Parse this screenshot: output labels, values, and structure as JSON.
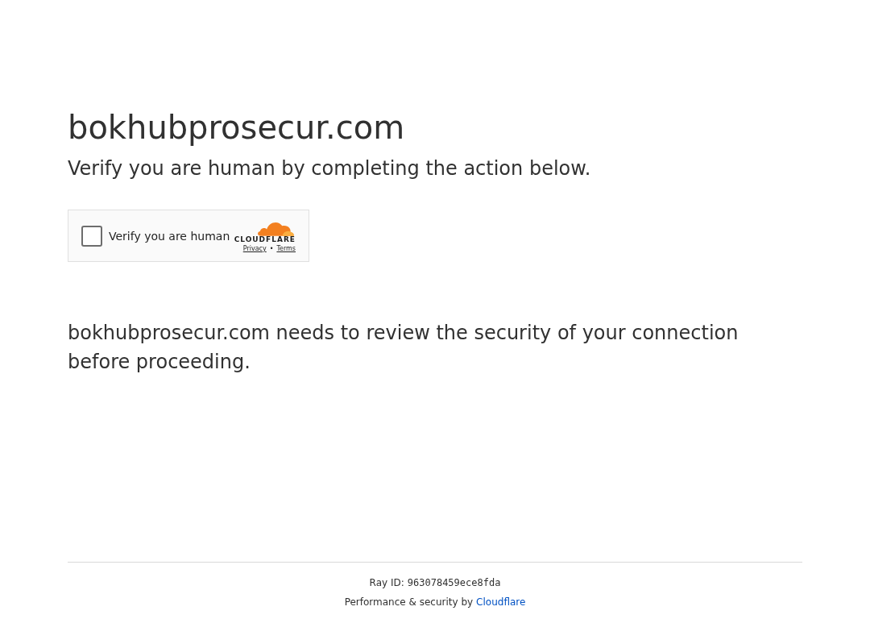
{
  "heading": "bokhubprosecur.com",
  "subheading": "Verify you are human by completing the action below.",
  "widget": {
    "checkbox": {
      "label": "Verify you are human",
      "checked": false
    },
    "brand": "CLOUDFLARE",
    "links": [
      "Privacy",
      "•",
      "Terms"
    ]
  },
  "message": "bokhubprosecur.com needs to review the security of your connection before proceeding.",
  "footer": {
    "ray_label": "Ray ID:",
    "ray_id": "963078459ece8fda",
    "credit": "Performance & security by",
    "credit_link": "Cloudflare"
  }
}
